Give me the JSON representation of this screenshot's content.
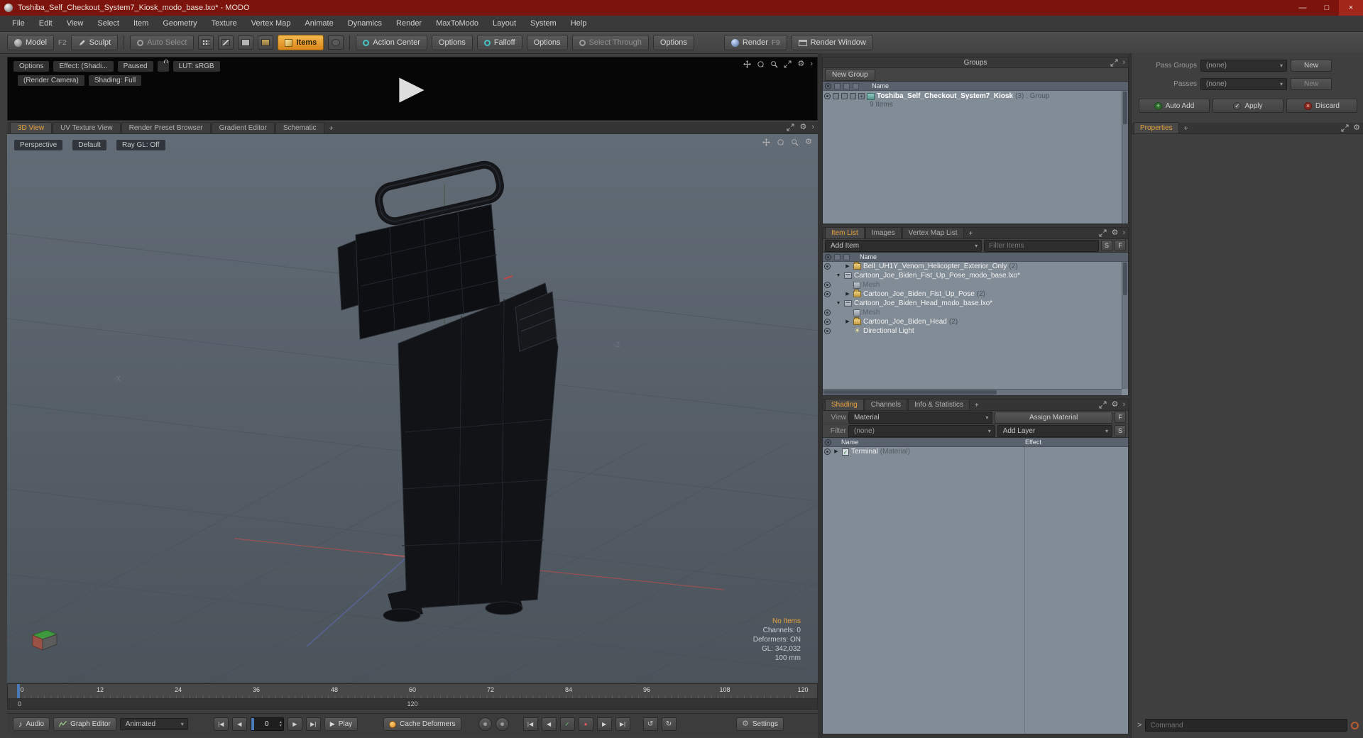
{
  "window": {
    "title": "Toshiba_Self_Checkout_System7_Kiosk_modo_base.lxo* - MODO",
    "minimize": "—",
    "maximize": "□",
    "close": "×"
  },
  "menu": {
    "items": [
      "File",
      "Edit",
      "View",
      "Select",
      "Item",
      "Geometry",
      "Texture",
      "Vertex Map",
      "Animate",
      "Dynamics",
      "Render",
      "MaxToModo",
      "Layout",
      "System",
      "Help"
    ]
  },
  "toolbar": {
    "model": "Model",
    "model_shortcut": "F2",
    "sculpt": "Sculpt",
    "auto_select": "Auto Select",
    "items": "Items",
    "action_center": "Action Center",
    "options": "Options",
    "falloff": "Falloff",
    "select_through": "Select Through",
    "render": "Render",
    "render_shortcut": "F9",
    "render_window": "Render Window"
  },
  "preview": {
    "options": "Options",
    "effect": "Effect: (Shadi...",
    "paused": "Paused",
    "lut": "LUT: sRGB",
    "camera": "(Render Camera)",
    "shading": "Shading: Full"
  },
  "viewport": {
    "tabs": [
      {
        "label": "3D View",
        "active": true
      },
      {
        "label": "UV Texture View"
      },
      {
        "label": "Render Preset Browser"
      },
      {
        "label": "Gradient Editor"
      },
      {
        "label": "Schematic"
      }
    ],
    "add_tab": "+",
    "perspective": "Perspective",
    "default_btn": "Default",
    "raygl": "Ray GL: Off",
    "label_neg_x": "-X",
    "label_neg_z": "-Z",
    "info": {
      "no_items": "No Items",
      "channels": "Channels: 0",
      "deformers": "Deformers: ON",
      "gl": "GL: 342,032",
      "scale": "100 mm"
    }
  },
  "timeline": {
    "marks": [
      "0",
      "12",
      "24",
      "36",
      "48",
      "60",
      "72",
      "84",
      "96",
      "108",
      "120"
    ],
    "range_start": "0",
    "range_end": "120"
  },
  "transport": {
    "audio": "Audio",
    "graph_editor": "Graph Editor",
    "animated": "Animated",
    "frame_value": "0",
    "play": "Play",
    "cache_deformers": "Cache Deformers",
    "settings": "Settings"
  },
  "groups": {
    "title": "Groups",
    "new_group": "New Group",
    "name_header": "Name",
    "row": {
      "name": "Toshiba_Self_Checkout_System7_Kiosk",
      "suffix": "(3) : Group",
      "items_count": "9 Items"
    }
  },
  "passes": {
    "pass_groups_label": "Pass Groups",
    "pass_groups_value": "(none)",
    "pass_groups_new": "New",
    "passes_label": "Passes",
    "passes_value": "(none)",
    "passes_new": "New",
    "auto_add": "Auto Add",
    "apply": "Apply",
    "discard": "Discard",
    "properties_tab": "Properties",
    "add_tab": "+"
  },
  "item_list": {
    "tabs": [
      {
        "label": "Item List",
        "active": true
      },
      {
        "label": "Images"
      },
      {
        "label": "Vertex Map List"
      }
    ],
    "add_tab": "+",
    "add_item": "Add Item",
    "filter_placeholder": "Filter Items",
    "s_button": "S",
    "f_button": "F",
    "name_header": "Name",
    "rows": [
      {
        "indent": 1,
        "arrow": "collapsed",
        "icon": "folder",
        "label": "Bell_UH1Y_Venom_Helicopter_Exterior_Only",
        "count": "(2)",
        "eye": true
      },
      {
        "indent": 0,
        "arrow": "expanded",
        "icon": "scene",
        "label": "Cartoon_Joe_Biden_Fist_Up_Pose_modo_base.lxo*",
        "eye": false
      },
      {
        "indent": 1,
        "arrow": "none",
        "icon": "mesh",
        "label": "Mesh",
        "gray": true,
        "eye": true
      },
      {
        "indent": 1,
        "arrow": "collapsed",
        "icon": "folder",
        "label": "Cartoon_Joe_Biden_Fist_Up_Pose",
        "count": "(2)",
        "eye": true
      },
      {
        "indent": 0,
        "arrow": "expanded",
        "icon": "scene",
        "label": "Cartoon_Joe_Biden_Head_modo_base.lxo*",
        "eye": false
      },
      {
        "indent": 1,
        "arrow": "none",
        "icon": "mesh",
        "label": "Mesh",
        "gray": true,
        "eye": true
      },
      {
        "indent": 1,
        "arrow": "collapsed",
        "icon": "folder",
        "label": "Cartoon_Joe_Biden_Head",
        "count": "(2)",
        "eye": true
      },
      {
        "indent": 1,
        "arrow": "none",
        "icon": "light",
        "label": "Directional Light",
        "eye": true
      }
    ]
  },
  "shading": {
    "tabs": [
      {
        "label": "Shading",
        "active": true
      },
      {
        "label": "Channels"
      },
      {
        "label": "Info & Statistics"
      }
    ],
    "add_tab": "+",
    "view_label": "View",
    "view_value": "Material",
    "assign_material": "Assign Material",
    "f_button": "F",
    "filter_label": "Filter",
    "filter_value": "(none)",
    "add_layer": "Add Layer",
    "s_button": "S",
    "name_header": "Name",
    "effect_header": "Effect",
    "rows": [
      {
        "label": "Terminal",
        "suffix": "(Material)"
      }
    ]
  },
  "command": {
    "prompt": ">",
    "placeholder": "Command"
  },
  "icons": {
    "play_large": "▶",
    "dropdown": "▾",
    "gear": "⚙",
    "chevron": "›",
    "note": "♪",
    "check": "✓",
    "key_dot": "●",
    "prev": "◀",
    "next": "▶",
    "skip_start": "|◀",
    "skip_end": "▶|",
    "loop_back": "↺",
    "loop_fwd": "↻",
    "plus": "+",
    "spin_up": "▴",
    "spin_down": "▾"
  }
}
